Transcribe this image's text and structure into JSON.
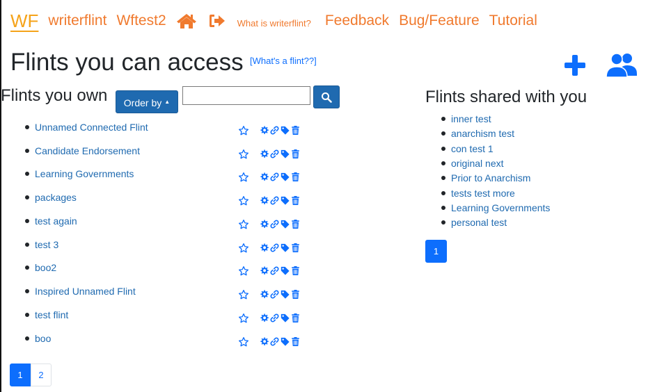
{
  "nav": {
    "logo": "WF",
    "site_name": "writerflint",
    "user": "Wftest2",
    "home_icon": "home-icon",
    "signout_icon": "sign-out-icon",
    "about": "What is writerflint?",
    "feedback": "Feedback",
    "bug": "Bug/Feature",
    "tutorial": "Tutorial"
  },
  "page": {
    "title": "Flints you can access",
    "whats_flint": "[What's a flint??]",
    "add_icon": "plus-icon",
    "users_icon": "users-icon"
  },
  "own": {
    "title": "Flints you own",
    "order_label": "Order by",
    "search_placeholder": "",
    "search_icon": "search-icon",
    "items": [
      {
        "label": "Unnamed Connected Flint"
      },
      {
        "label": "Candidate Endorsement"
      },
      {
        "label": "Learning Governments"
      },
      {
        "label": "packages"
      },
      {
        "label": "test again"
      },
      {
        "label": "test 3"
      },
      {
        "label": "boo2"
      },
      {
        "label": "Inspired Unnamed Flint"
      },
      {
        "label": "test flint"
      },
      {
        "label": "boo"
      }
    ],
    "pages": [
      "1",
      "2"
    ],
    "active_page": "1"
  },
  "shared": {
    "title": "Flints shared with you",
    "items": [
      {
        "label": "inner test"
      },
      {
        "label": "anarchism test"
      },
      {
        "label": "con test 1"
      },
      {
        "label": "original next"
      },
      {
        "label": "Prior to Anarchism"
      },
      {
        "label": "tests test more"
      },
      {
        "label": "Learning Governments"
      },
      {
        "label": "personal test"
      }
    ],
    "pages": [
      "1"
    ],
    "active_page": "1"
  },
  "colors": {
    "nav_orange": "#f07a2e",
    "logo_yellow": "#f5a31a",
    "primary_blue": "#0d6efd",
    "link_blue": "#1f6ab0",
    "button_dark_blue": "#1f6ab0"
  }
}
